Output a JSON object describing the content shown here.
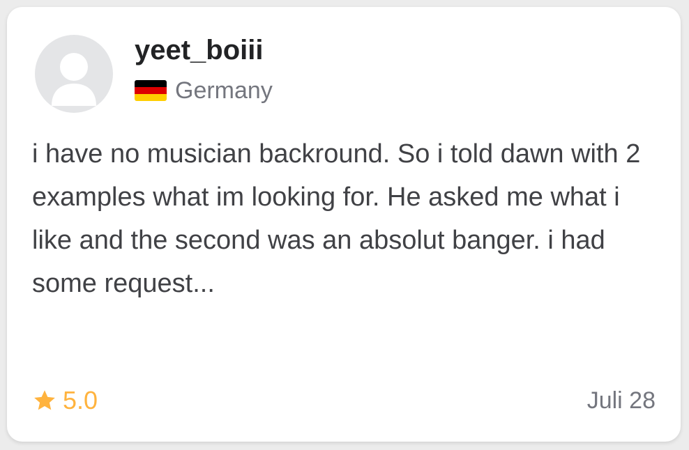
{
  "review": {
    "username": "yeet_boiii",
    "country": {
      "name": "Germany",
      "flag_icon": "germany-flag-icon",
      "flag_colors": [
        "#000000",
        "#dd0000",
        "#ffce00"
      ]
    },
    "text": "i have no musician backround. So i told dawn with 2 examples what im looking for. He asked me what i like and the second was an absolut banger. i had some request...",
    "rating": "5.0",
    "rating_icon": "star-icon",
    "date": "Juli 28",
    "avatar_icon": "default-user-avatar-icon"
  },
  "colors": {
    "star": "#ffb33e",
    "muted_text": "#74767e",
    "body_text": "#404145",
    "username": "#222325"
  }
}
